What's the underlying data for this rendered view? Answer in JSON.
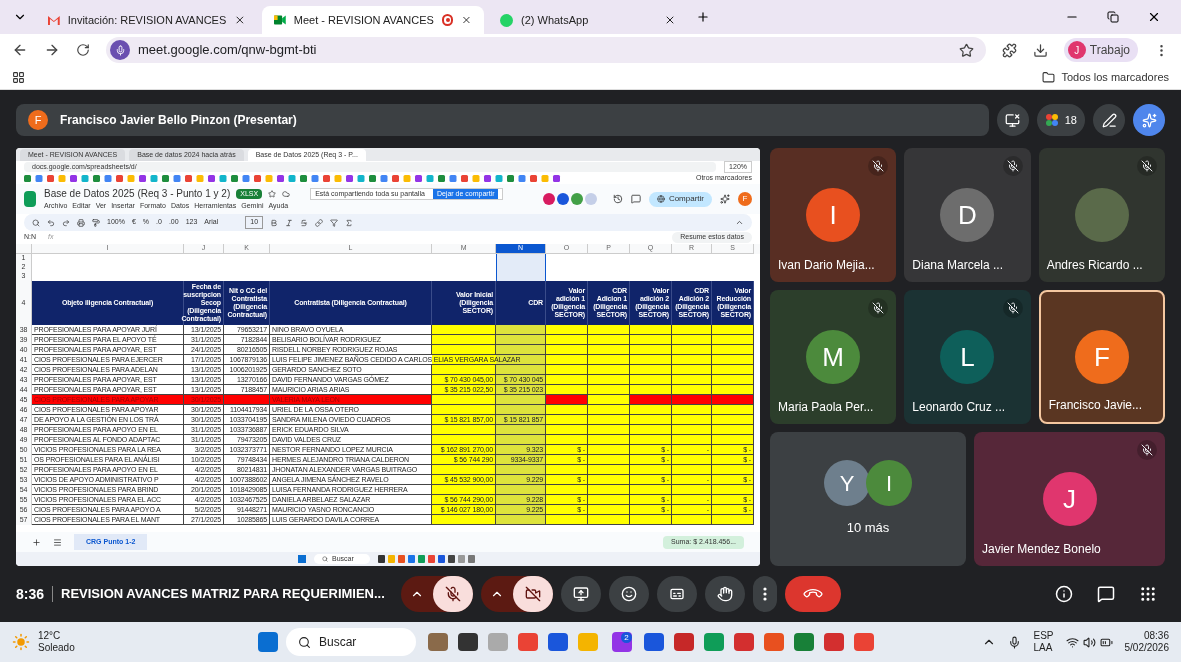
{
  "browser": {
    "tabs": [
      {
        "kind": "gmail",
        "title": "Invitación: REVISION AVANCES",
        "selected": false
      },
      {
        "kind": "meet",
        "title": "Meet - REVISION AVANCES",
        "selected": true
      },
      {
        "kind": "whatsapp",
        "title": "(2) WhatsApp",
        "selected": false
      }
    ],
    "url": "meet.google.com/qnw-bgmt-bti",
    "profile": "Trabajo",
    "profile_initial": "J",
    "bookmarks_folder": "Todos los marcadores"
  },
  "meet": {
    "presenter": {
      "initial": "F",
      "name": "Francisco Javier Bello Pinzon (Presentar)"
    },
    "participants_count": "18",
    "shared_screen": {
      "tabs": [
        {
          "title": "Meet - REVISION AVANCES",
          "selected": false
        },
        {
          "title": "Base de datos 2024 hacia atrás",
          "selected": false
        },
        {
          "title": "Base de Datos 2025 (Req 3 - P...",
          "selected": true
        }
      ],
      "url": "docs.google.com/spreadsheets/d/",
      "zoom": "120%",
      "other_bookmarks": "Otros marcadores",
      "share_notice": "Está compartiendo toda su pantalla",
      "stop_share": "Dejar de compartir",
      "doc_title": "Base de Datos 2025 (Req 3 - Punto 1 y 2)",
      "badge": "XLSX",
      "menus": [
        "Archivo",
        "Editar",
        "Ver",
        "Insertar",
        "Formato",
        "Datos",
        "Herramientas",
        "Gemini",
        "Ayuda"
      ],
      "share_button": "Compartir",
      "user_initial": "F",
      "toolbar": {
        "zoom": "100%",
        "currency": "€",
        "percent": "%",
        "dec_less": ".0",
        "dec_more": ".00",
        "format": "123",
        "font": "Arial",
        "size": "10"
      },
      "name_box": "N:N",
      "fx": "fx",
      "summarize": "Resume estos datos",
      "columns": [
        {
          "letter": "I",
          "selected": false
        },
        {
          "letter": "J",
          "selected": false
        },
        {
          "letter": "K",
          "selected": false
        },
        {
          "letter": "L",
          "selected": false
        },
        {
          "letter": "M",
          "selected": false
        },
        {
          "letter": "N",
          "selected": true
        },
        {
          "letter": "O",
          "selected": false
        },
        {
          "letter": "P",
          "selected": false
        },
        {
          "letter": "Q",
          "selected": false
        },
        {
          "letter": "R",
          "selected": false
        },
        {
          "letter": "S",
          "selected": false
        }
      ],
      "blank_rows": [
        "1",
        "2",
        "3"
      ],
      "header_row": "4",
      "header": [
        "Objeto iligencia Contractual)",
        "Fecha de suscripcion Secop (Diligencia Contractual)",
        "Nit o CC del Contratista (Diligencia Contractual)",
        "Contratista (Diligencia Contractual)",
        "Valor Inicial (Diligencia SECTOR)",
        "CDR",
        "Valor adición 1 (Diligencia SECTOR)",
        "CDR Adicion 1 (Diligencia SECTOR)",
        "Valor adición 2 (Diligencia SECTOR)",
        "CDR Adición 2 (Diligencia SECTOR)",
        "Valor Reducción (Diligencia SECTOR)"
      ],
      "rows": [
        {
          "n": "38",
          "flagged": false,
          "cells": {
            "I": "PROFESIONALES PARA APOYAR JURÍ",
            "J": "13/1/2025",
            "K": "79653217",
            "L": "NINO BRAVO OYUELA"
          }
        },
        {
          "n": "39",
          "flagged": false,
          "cells": {
            "I": "PROFESIONALES PARA EL APOYO TÉ",
            "J": "31/1/2025",
            "K": "7182844",
            "L": "BELISARIO BOLÍVAR RODRIGUEZ"
          }
        },
        {
          "n": "40",
          "flagged": false,
          "cells": {
            "I": "PROFESIONALES PARA APOYAR, EST",
            "J": "24/1/2025",
            "K": "80216505",
            "L": "RISDELL NORBEY RODRIGUEZ ROJAS"
          }
        },
        {
          "n": "41",
          "flagged": false,
          "cells": {
            "I": "CIOS PROFESIONALES PARA EJERCER",
            "J": "17/1/2025",
            "K": "1067879136",
            "L": "LUIS FELIPE JIMENEZ BAÑOS CEDIDO A CARLOS ELIAS VERGARA SALAZAR"
          }
        },
        {
          "n": "42",
          "flagged": false,
          "cells": {
            "I": "CIOS PROFESIONALES PARA ADELAN",
            "J": "13/1/2025",
            "K": "1006201925",
            "L": "GERARDO SANCHEZ SOTO"
          }
        },
        {
          "n": "43",
          "flagged": false,
          "cells": {
            "I": "PROFESIONALES PARA APOYAR, EST",
            "J": "13/1/2025",
            "K": "13270166",
            "L": "DAVID FERNANDO VARGAS GÓMEZ",
            "M": "$ 70 430 045,00",
            "N": "$ 70 430 045"
          }
        },
        {
          "n": "44",
          "flagged": false,
          "cells": {
            "I": "PROFESIONALES PARA APOYAR, EST",
            "J": "13/1/2025",
            "K": "7188457",
            "L": "MAURICIO ARIAS ARIAS",
            "M": "$ 35 215 022,50",
            "N": "$ 35 215 023"
          }
        },
        {
          "n": "45",
          "flagged": true,
          "cells": {
            "I": "CIOS PROFESIONALES PARA APOYAR",
            "J": "30/1/2025",
            "L": "VALERIA MAYA LEON"
          }
        },
        {
          "n": "46",
          "flagged": false,
          "cells": {
            "I": "CIOS PROFESIONALES PARA APOYAR",
            "J": "30/1/2025",
            "K": "1104417934",
            "L": "URIEL DE LA OSSA OTERO"
          }
        },
        {
          "n": "47",
          "flagged": false,
          "cells": {
            "I": "DE APOYO A LA GESTIÓN EN LOS TRÁ",
            "J": "30/1/2025",
            "K": "1033704195",
            "L": "SANDRA MILENA OVIEDO CUADROS",
            "M": "$ 15 821 857,00",
            "N": "$ 15 821 857"
          }
        },
        {
          "n": "48",
          "flagged": false,
          "cells": {
            "I": "PROFESIONALES PARA APOYO EN EL",
            "J": "31/1/2025",
            "K": "1033736887",
            "L": "ERICK EDUARDO SILVA"
          }
        },
        {
          "n": "49",
          "flagged": false,
          "cells": {
            "I": "PROFESIONALES AL FONDO ADAPTAC",
            "J": "31/1/2025",
            "K": "79473205",
            "L": "DAVID VALDES CRUZ"
          }
        },
        {
          "n": "50",
          "flagged": false,
          "cells": {
            "I": "VICIOS PROFESIONALES PARA LA REA",
            "J": "3/2/2025",
            "K": "1032373771",
            "L": "NESTOR FERNANDO LOPEZ MURCIA",
            "M": "$ 162 891 270,00",
            "N": "9.323",
            "O": "$ -",
            "Q": "$ -",
            "R": "-",
            "S": "$ -"
          }
        },
        {
          "n": "51",
          "flagged": false,
          "cells": {
            "I": "OS PROFESIONALES PARA EL ANÁLISI",
            "J": "10/2/2025",
            "K": "79748434",
            "L": "HERMES ALEJANDRO TRIANA CALDERON",
            "M": "$ 56 744 290",
            "N": "9334-9337",
            "O": "$ -",
            "Q": "$ -",
            "S": "$ -"
          }
        },
        {
          "n": "52",
          "flagged": false,
          "cells": {
            "I": "PROFESIONALES PARA APOYO EN EL",
            "J": "4/2/2025",
            "K": "80214831",
            "L": "JHONATAN ALEXANDER VARGAS BUITRAGO"
          }
        },
        {
          "n": "53",
          "flagged": false,
          "cells": {
            "I": "VICIOS DE APOYO ADMINISTRATIVO P",
            "J": "4/2/2025",
            "K": "1007388602",
            "L": "ANGELA JIMENA SÁNCHEZ RAVELO",
            "M": "$ 45 532 900,00",
            "N": "9.229",
            "O": "$ -",
            "Q": "$ -",
            "R": "-",
            "S": "$ -"
          }
        },
        {
          "n": "54",
          "flagged": false,
          "cells": {
            "I": "VICIOS PROFESIONALES PARA BRIND",
            "J": "20/1/2025",
            "K": "1018429085",
            "L": "LUISA FERNANDA RODRIGUEZ HERRERA"
          }
        },
        {
          "n": "55",
          "flagged": false,
          "cells": {
            "I": "VICIOS PROFESIONALES PARA EL ACC",
            "J": "4/2/2025",
            "K": "1032467525",
            "L": "DANIELA ARBELAEZ SALAZAR",
            "M": "$ 56 744 290,00",
            "N": "9.228",
            "O": "$ -",
            "Q": "$ -",
            "R": "-",
            "S": "$ -"
          }
        },
        {
          "n": "56",
          "flagged": false,
          "cells": {
            "I": "CIOS PROFESIONALES PARA APOYO A",
            "J": "5/2/2025",
            "K": "91448271",
            "L": "MAURICIO YASNO RONCANCIO",
            "M": "$ 146 027 180,00",
            "N": "9.225",
            "O": "$ -",
            "Q": "$ -",
            "R": "-",
            "S": "$ -"
          }
        },
        {
          "n": "57",
          "flagged": false,
          "cells": {
            "I": "CIOS PROFESIONALES PARA EL MANT",
            "J": "27/1/2025",
            "K": "10285865",
            "L": "LUIS GERARDO DAVILA CORREA"
          }
        }
      ],
      "sheet_tab": "CRG Punto 1-2",
      "sum": "Suma: $ 2.418.456...",
      "search": "Buscar"
    },
    "tiles": [
      {
        "kind": "avatar",
        "initial": "I",
        "name": "Ivan Dario Mejia...",
        "color": "#e8501f",
        "muted": true,
        "speaking": false
      },
      {
        "kind": "avatar",
        "initial": "D",
        "name": "Diana Marcela ...",
        "color": "#6d6d6d",
        "muted": true,
        "speaking": false
      },
      {
        "kind": "photo",
        "name": "Andres Ricardo ...",
        "color": "#5a6a4a",
        "muted": true,
        "speaking": false
      },
      {
        "kind": "avatar",
        "initial": "M",
        "name": "Maria Paola Per...",
        "color": "#4c8a3c",
        "muted": true,
        "speaking": false
      },
      {
        "kind": "avatar",
        "initial": "L",
        "name": "Leonardo Cruz ...",
        "color": "#0e5f5a",
        "muted": true,
        "speaking": false
      },
      {
        "kind": "avatar",
        "initial": "F",
        "name": "Francisco Javie...",
        "color": "#ef6c1c",
        "muted": false,
        "speaking": true
      }
    ],
    "more_tile": {
      "initials": [
        {
          "letter": "Y",
          "color": "#6e7f8d"
        },
        {
          "letter": "I",
          "color": "#4c8a3c"
        }
      ],
      "label": "10 más"
    },
    "last_tile": {
      "initial": "J",
      "name": "Javier Mendez Bonelo",
      "color": "#e0366e",
      "muted": true
    },
    "meeting": {
      "time": "8:36",
      "title": "REVISION AVANCES MATRIZ PARA REQUERIMIEN..."
    },
    "controls": {
      "mic_on": false,
      "camera_on": false
    }
  },
  "taskbar": {
    "temp": "12°C",
    "weather": "Soleado",
    "search": "Buscar",
    "badge": "2",
    "lang": "ESP",
    "layout": "LAA",
    "time": "08:36",
    "date": "5/02/2026"
  }
}
